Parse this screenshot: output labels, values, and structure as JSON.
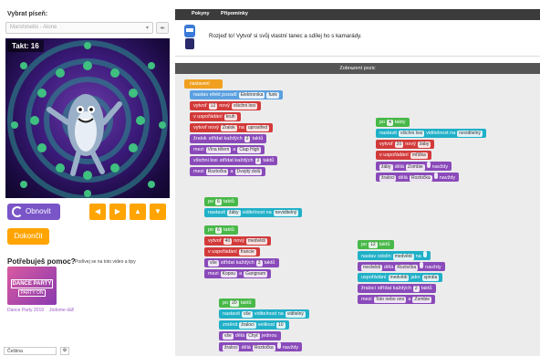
{
  "left": {
    "select_label": "Vybrat píseň:",
    "select_value": "Marshmello - Alone",
    "takt_label": "Takt: 16",
    "reset_label": "Obnovit",
    "arrows": [
      "◀",
      "▶",
      "▲",
      "▼"
    ],
    "done_label": "Dokončit",
    "help_title": "Potřebuješ pomoc?",
    "help_sub": "Podívej se na toto video a tipy",
    "thumb_line1": "DANCE PARTY",
    "thumb_line2": "PARTY ON",
    "thumb_caption": "Dance Party 2019",
    "thumb_caption2": "Jodome dál!",
    "language": "Čeština"
  },
  "top": {
    "tabs": [
      "Pokyny",
      "Připomínky"
    ],
    "instruction": "Rozjeď to! Vytvoř si svůj vlastní tanec a sdílej ho s kamarády."
  },
  "workspace": {
    "header": "Zobrazení pozic",
    "setup": {
      "hat": "nastavení",
      "bg1": "nastav efekt pozadí",
      "bg2": "Elektronika",
      "bg3": "funk",
      "make1": "vytvoř",
      "make1n": "12",
      "make1b": "nový",
      "make1c": "všichni losi",
      "form1": "v uspořádání",
      "form1b": "kruh",
      "make2": "vytvoř nový",
      "make2b": "Žralok",
      "make2c": "na",
      "make2d": "uprostřed",
      "alt1": "žralok",
      "alt1b": "střídat každých",
      "alt1c": "2",
      "alt1d": "taktů",
      "mix1": "mezi",
      "mix1b": "Vlna tělem",
      "mix1c": "a",
      "mix1d": "Clap High",
      "alt2": "všichni losi",
      "alt2b": "střídat každých",
      "alt2c": "2",
      "alt2d": "taktů",
      "mix2": "mezi",
      "mix2b": "Roztočka",
      "mix2c": "a",
      "mix2d": "Dvojitý dolů"
    },
    "s2": {
      "hat": "po",
      "n": "6",
      "unit": "taktů",
      "set": "nastavit",
      "who": "žáby",
      "prop": "viditelnost na",
      "val": "neviditelný"
    },
    "s3": {
      "hat": "po",
      "n": "6",
      "unit": "taktů",
      "make": "vytvoř",
      "num": "40",
      "nw": "nový",
      "what": "medvědi",
      "form": "v uspořádání",
      "fv": "francie",
      "alt": "vše",
      "altb": "střídat každých",
      "altc": "3",
      "altd": "taktů",
      "mix": "mezi",
      "mixb": "Kopou",
      "mixc": "a",
      "mixd": "Gangnam"
    },
    "s4": {
      "hat": "po",
      "n": "4",
      "unit": "takty",
      "set": "nastavit",
      "who": "všichni losi",
      "prop": "viditelnost na",
      "val": "neviditelný",
      "make": "vytvoř",
      "num": "20",
      "nw": "nový",
      "what": "žáby",
      "form": "v uspořádání",
      "fv": "mřížka",
      "d1": "žáby",
      "d1b": "dělá",
      "d1c": "Zombie",
      "d1d": "",
      "d1e": "navždy",
      "d2": "žraloci",
      "d2b": "dělá",
      "d2c": "Roztočka",
      "d2d": "",
      "d2e": "navždy"
    },
    "s5": {
      "hat": "po",
      "n": "12",
      "unit": "taktů",
      "set": "nastav odstín",
      "who": "medvědi",
      "val": "na",
      "vn": "",
      "d": "medvědi",
      "db": "dělá",
      "dc": "Roztočka",
      "dd": "",
      "de": "navždy",
      "f": "uspořádání",
      "fb": "medvědi",
      "fc": "jako",
      "fd": "spirála",
      "alt": "žraloci",
      "altb": "střídat každých",
      "altc": "2",
      "altd": "taktů",
      "mix": "mezi",
      "mixb": "Toto nebo ono",
      "mixc": "a",
      "mixd": "Zombie"
    },
    "s6": {
      "hat": "po",
      "n": "20",
      "unit": "taktů",
      "set": "nastavit",
      "who": "vše",
      "prop": "viditelnost na",
      "val": "viditelný",
      "chg": "změnit",
      "cw": "žraloci",
      "cp": "velikost",
      "cv": "10",
      "m": "vše",
      "mb": "dělá",
      "mc": "Chyť",
      "md": "jednou",
      "d": "žraloci",
      "db": "dělá",
      "dc": "Roztočka",
      "dd": "",
      "de": "navždy"
    }
  }
}
